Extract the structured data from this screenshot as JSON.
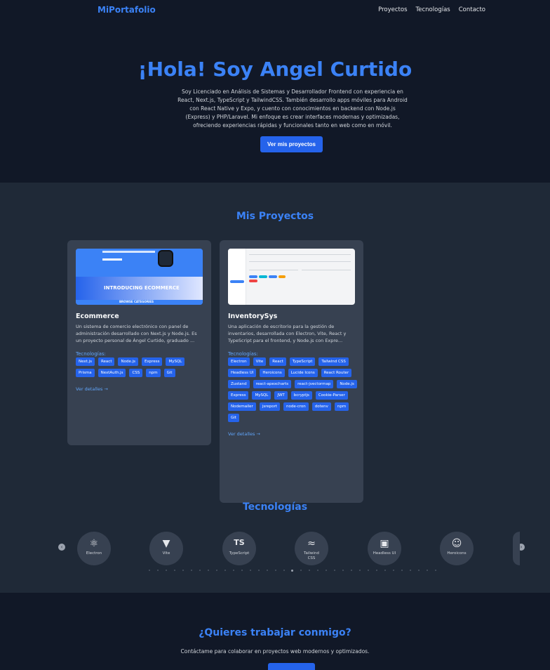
{
  "header": {
    "brand": "MiPortafolio",
    "nav": [
      "Proyectos",
      "Tecnologías",
      "Contacto"
    ]
  },
  "hero": {
    "title": "¡Hola! Soy Angel Curtido",
    "description": "Soy Licenciado en Análisis de Sistemas y Desarrollador Frontend con experiencia en React, Next.js, TypeScript y TailwindCSS. También desarrollo apps móviles para Android con React Native y Expo, y cuento con conocimientos en backend con Node.js (Express) y PHP/Laravel. Mi enfoque es crear interfaces modernas y optimizadas, ofreciendo experiencias rápidas y funcionales tanto en web como en móvil.",
    "cta": "Ver mis proyectos"
  },
  "projects": {
    "title": "Mis Proyectos",
    "items": [
      {
        "name": "Ecommerce",
        "description": "Un sistema de comercio electrónico con panel de administración desarrollado con Next.js y Node.js. Es un proyecto personal de Ángel Curtido, graduado ...",
        "tech_label": "Tecnologías:",
        "tags": [
          "Next.js",
          "React",
          "Node.js",
          "Express",
          "MySQL",
          "Prisma",
          "NextAuth.js",
          "CSS",
          "npm",
          "Git"
        ],
        "details": "Ver detalles →",
        "thumb_text": "INTRODUCING ECOMMERCE",
        "thumb_footer": "BROWSE CATEGORIES"
      },
      {
        "name": "InventorySys",
        "description": "Una aplicación de escritorio para la gestión de inventarios, desarrollada con Electron, Vite, React y TypeScript para el frontend, y Node.js con Expre...",
        "tech_label": "Tecnologías:",
        "tags": [
          "Electron",
          "Vite",
          "React",
          "TypeScript",
          "Tailwind CSS",
          "Headless UI",
          "Heroicons",
          "Lucide Icons",
          "React Router",
          "Zustand",
          "react-apexcharts",
          "react-jvectormap",
          "Node.js",
          "Express",
          "MySQL",
          "JWT",
          "bcryptjs",
          "Cookie-Parser",
          "Nodemailer",
          "jsreport",
          "node-cron",
          "dotenv",
          "npm",
          "Git"
        ],
        "details": "Ver detalles →"
      }
    ]
  },
  "technologies": {
    "title": "Tecnologías",
    "items": [
      {
        "label": "Electron",
        "icon": "electron-icon",
        "glyph": "⚛"
      },
      {
        "label": "Vite",
        "icon": "vite-icon",
        "glyph": "▼"
      },
      {
        "label": "TypeScript",
        "icon": "typescript-icon",
        "glyph": "TS"
      },
      {
        "label": "Tailwind CSS",
        "icon": "tailwind-icon",
        "glyph": "≈"
      },
      {
        "label": "Headless UI",
        "icon": "headlessui-icon",
        "glyph": "▣"
      },
      {
        "label": "Heroicons",
        "icon": "heroicons-icon",
        "glyph": "☺"
      }
    ],
    "prev": "‹",
    "next": "›"
  },
  "contact": {
    "title": "¿Quieres trabajar conmigo?",
    "subtitle": "Contáctame para colaborar en proyectos web modernos y optimizados."
  },
  "colors": {
    "background": "#111827",
    "section": "#1f2937",
    "card": "#374151",
    "accent": "#3b82f6",
    "button": "#2563eb"
  }
}
